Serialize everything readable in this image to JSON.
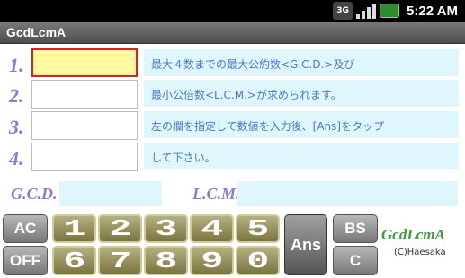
{
  "status_bar": {
    "network": "3G",
    "time": "5:22 AM"
  },
  "app": {
    "title": "GcdLcmA"
  },
  "rows": [
    {
      "label": "1.",
      "value": "",
      "info": "最大４数までの最大公約数<G.C.D.>及び"
    },
    {
      "label": "2.",
      "value": "",
      "info": "最小公倍数<L.C.M.>が求められます。"
    },
    {
      "label": "3.",
      "value": "",
      "info": "左の欄を指定して数値を入力後、[Ans]をタップ"
    },
    {
      "label": "4.",
      "value": "",
      "info": "して下さい。"
    }
  ],
  "results": {
    "gcd_label": "G.C.D.",
    "gcd_value": "",
    "lcm_label": "L.C.M.",
    "lcm_value": ""
  },
  "keypad": {
    "ac": "AC",
    "off": "OFF",
    "digits_top": [
      "1",
      "2",
      "3",
      "4",
      "5"
    ],
    "digits_bottom": [
      "6",
      "7",
      "8",
      "9",
      "0"
    ],
    "ans": "Ans",
    "bs": "BS",
    "c": "C"
  },
  "brand": {
    "name": "GcdLcmA",
    "copyright": "(C)Haesaka"
  },
  "colors": {
    "label_purple": "#8a7ad6",
    "info_bg": "#dff7fc",
    "active_field": "#fffaa0",
    "active_border": "#e02020",
    "brand_green": "#3e9a3e"
  }
}
